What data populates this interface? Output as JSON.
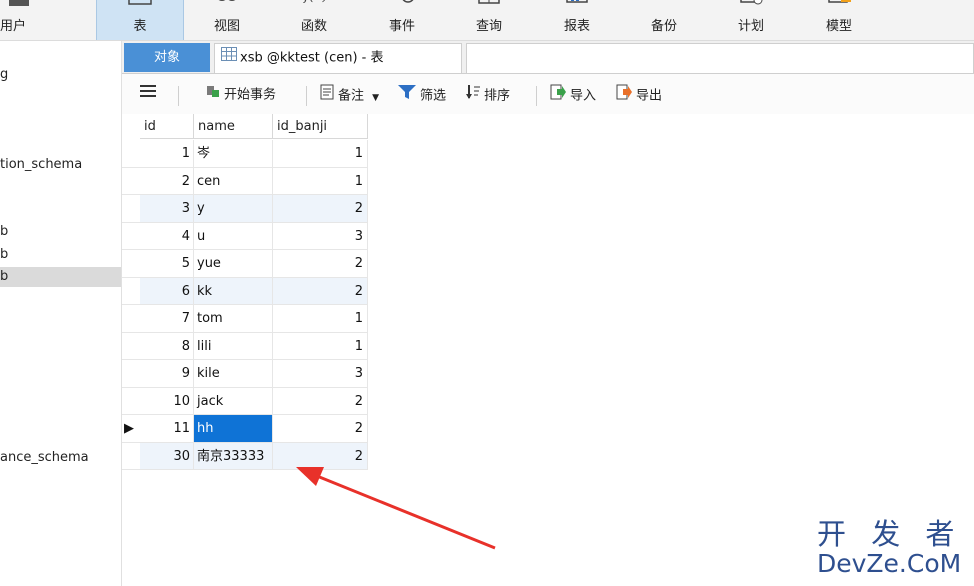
{
  "ribbon": {
    "items": [
      {
        "label": "用户",
        "icon": "user-icon"
      },
      {
        "label": "表",
        "icon": "table-icon",
        "active": true
      },
      {
        "label": "视图",
        "icon": "view-icon"
      },
      {
        "label": "函数",
        "icon": "function-icon"
      },
      {
        "label": "事件",
        "icon": "event-icon"
      },
      {
        "label": "查询",
        "icon": "query-icon"
      },
      {
        "label": "报表",
        "icon": "report-icon"
      },
      {
        "label": "备份",
        "icon": "backup-icon"
      },
      {
        "label": "计划",
        "icon": "schedule-icon"
      },
      {
        "label": "模型",
        "icon": "model-icon"
      }
    ]
  },
  "sidebar": {
    "items": [
      "g",
      "tion_schema",
      "b",
      "b",
      "b",
      "ance_schema"
    ]
  },
  "tabs": {
    "objects_label": "对象",
    "table_tab_label": "xsb @kktest (cen) - 表"
  },
  "toolbar": {
    "menu_icon": "hamburger-icon",
    "begin_transaction": "开始事务",
    "memo": "备注",
    "filter": "筛选",
    "sort": "排序",
    "import": "导入",
    "export": "导出"
  },
  "table": {
    "columns": [
      "id",
      "name",
      "id_banji"
    ],
    "rows": [
      {
        "id": "1",
        "name": "岑",
        "id_banji": "1"
      },
      {
        "id": "2",
        "name": "cen",
        "id_banji": "1"
      },
      {
        "id": "3",
        "name": "y",
        "id_banji": "2"
      },
      {
        "id": "4",
        "name": "u",
        "id_banji": "3"
      },
      {
        "id": "5",
        "name": "yue",
        "id_banji": "2"
      },
      {
        "id": "6",
        "name": "kk",
        "id_banji": "2"
      },
      {
        "id": "7",
        "name": "tom",
        "id_banji": "1"
      },
      {
        "id": "8",
        "name": "lili",
        "id_banji": "1"
      },
      {
        "id": "9",
        "name": "kile",
        "id_banji": "3"
      },
      {
        "id": "10",
        "name": "jack",
        "id_banji": "2"
      },
      {
        "id": "11",
        "name": "hh",
        "id_banji": "2"
      },
      {
        "id": "30",
        "name": "南京33333",
        "id_banji": "2"
      }
    ],
    "current_row_indicator": "▶"
  },
  "watermark": {
    "line1": "开 发 者",
    "line2": "DevZe.CoM"
  },
  "colors": {
    "accent": "#4a90d6",
    "selection": "#0f73d6",
    "annotation_arrow": "#e8312a",
    "watermark": "#2e4f8f"
  }
}
